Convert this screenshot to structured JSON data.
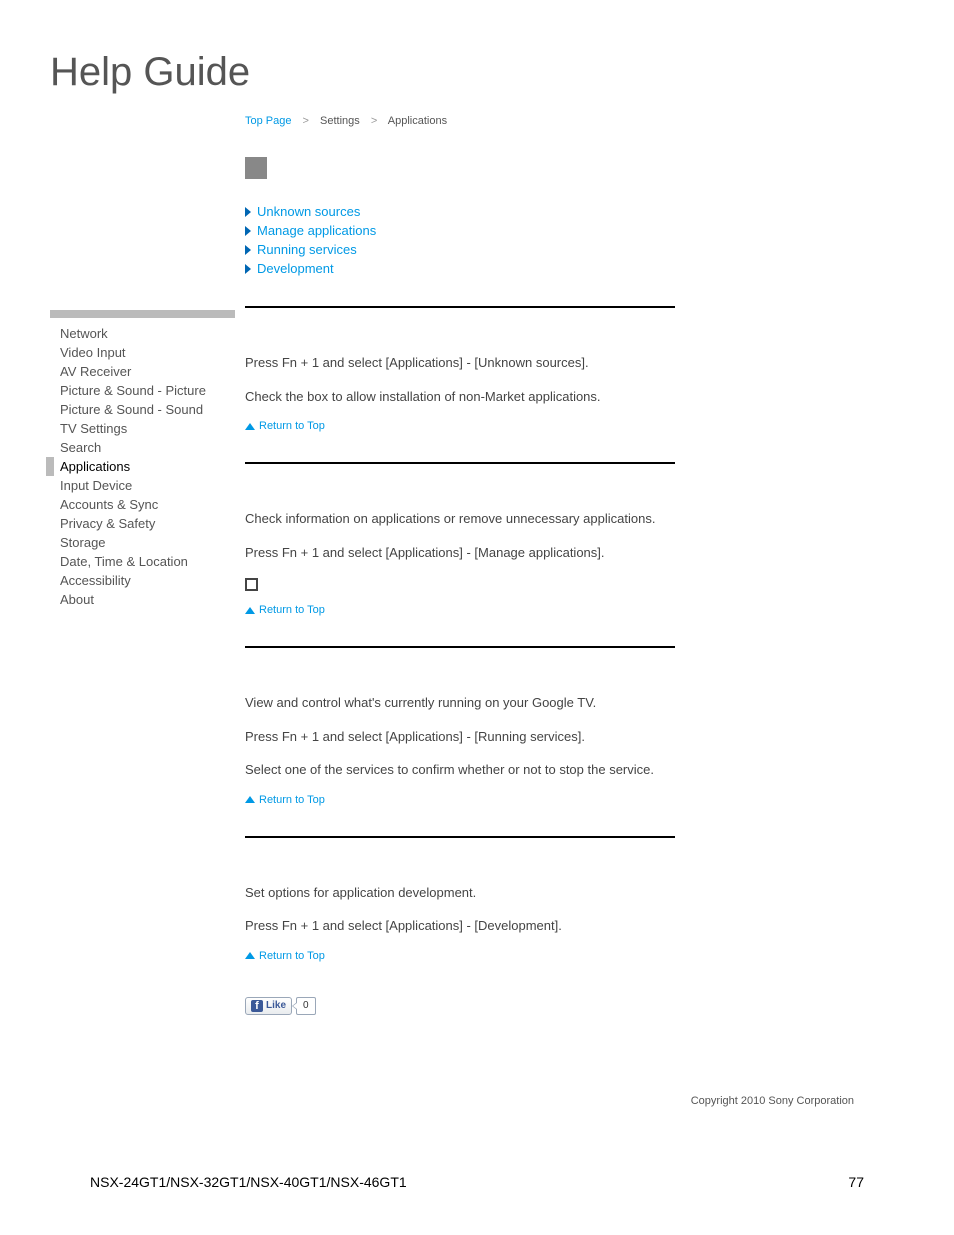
{
  "page_title": "Help Guide",
  "breadcrumb": {
    "top_page": "Top Page",
    "settings": "Settings",
    "applications": "Applications"
  },
  "toc": [
    "Unknown sources",
    "Manage applications",
    "Running services",
    "Development"
  ],
  "sidebar": {
    "items": [
      "Network",
      "Video Input",
      "AV Receiver",
      "Picture & Sound - Picture",
      "Picture & Sound - Sound",
      "TV Settings",
      "Search",
      "Applications",
      "Input Device",
      "Accounts & Sync",
      "Privacy & Safety",
      "Storage",
      "Date, Time & Location",
      "Accessibility",
      "About"
    ],
    "active_index": 7
  },
  "sections": {
    "unknown_sources": {
      "p1": "Press Fn + 1 and select [Applications] - [Unknown sources].",
      "p2": "Check the box to allow installation of non-Market applications."
    },
    "manage_applications": {
      "p1": "Check information on applications or remove unnecessary applications.",
      "p2": "Press Fn + 1 and select [Applications] - [Manage applications]."
    },
    "running_services": {
      "p1": "View and control what's currently running on your Google TV.",
      "p2": "Press Fn + 1 and select [Applications] - [Running services].",
      "p3": "Select one of the services to confirm whether or not to stop the service."
    },
    "development": {
      "p1": "Set options for application development.",
      "p2": "Press Fn + 1 and select [Applications] - [Development]."
    }
  },
  "return_to_top": "Return to Top",
  "like": {
    "label": "Like",
    "count": "0"
  },
  "copyright": "Copyright 2010 Sony Corporation",
  "footer": {
    "model": "NSX-24GT1/NSX-32GT1/NSX-40GT1/NSX-46GT1",
    "page": "77"
  }
}
